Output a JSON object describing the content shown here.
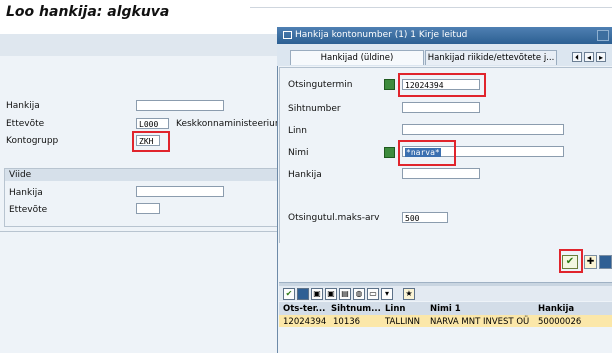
{
  "main": {
    "title": "Loo hankija: algkuva",
    "fields": {
      "hankija_label": "Hankija",
      "ettevote_label": "Ettevõte",
      "ettevote_value": "L000",
      "ettevote_desc": "Keskkonnaministeerium",
      "kontogrupp_label": "Kontogrupp",
      "kontogrupp_value": "ZKH"
    },
    "viide": {
      "heading": "Viide",
      "hankija_label": "Hankija",
      "ettevote_label": "Ettevõte"
    }
  },
  "dialog": {
    "title": "Hankija kontonumber (1)   1 Kirje leitud",
    "tabs": [
      "Hankijad (üldine)",
      "Hankijad riikide/ettevõtete j..."
    ],
    "fields": {
      "otsingutermin_label": "Otsingutermin",
      "otsingutermin_value": "12024394",
      "sihtnumber_label": "Sihtnumber",
      "linn_label": "Linn",
      "nimi_label": "Nimi",
      "nimi_value": "*narva*",
      "hankija_label": "Hankija",
      "maxhits_label": "Otsingutul.maks-arv",
      "maxhits_value": "500"
    },
    "results": {
      "columns": [
        "Ots-ter...",
        "Sihtnum...",
        "Linn",
        "Nimi 1",
        "Hankija"
      ],
      "rows": [
        [
          "12024394",
          "10136",
          "TALLINN",
          "NARVA MNT INVEST OÜ",
          "50000026"
        ]
      ]
    },
    "accent_color": "#2c5f92",
    "highlight_color": "#e0242c"
  }
}
